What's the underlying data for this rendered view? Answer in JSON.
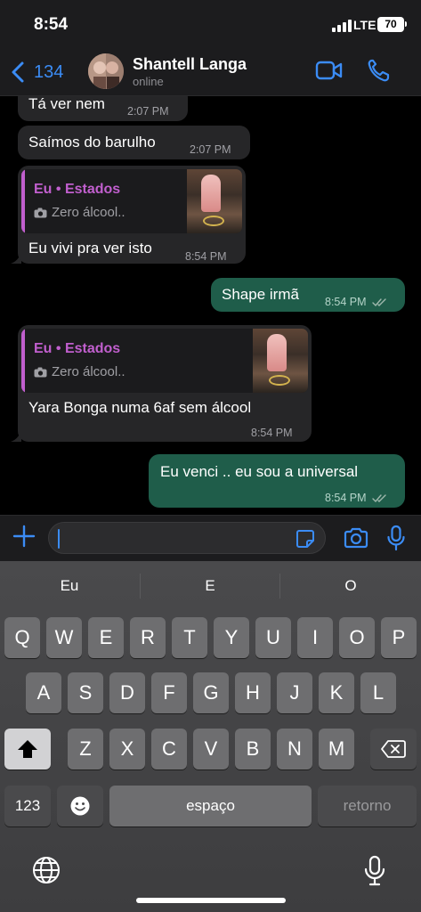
{
  "status_bar": {
    "time": "8:54",
    "network": "LTE",
    "battery": "70"
  },
  "header": {
    "back_count": "134",
    "contact_name": "Shantell Langa",
    "contact_status": "online",
    "icons": {
      "back": "chevron-left-icon",
      "video": "video-camera-icon",
      "call": "phone-icon"
    }
  },
  "messages": [
    {
      "direction": "in",
      "text": "Tá ver nem",
      "time": "2:07 PM"
    },
    {
      "direction": "in",
      "text": "Saímos do barulho",
      "time": "2:07 PM"
    },
    {
      "direction": "in",
      "quote_author": "Eu • Estados",
      "quote_text": "Zero álcool..",
      "text": "Eu vivi pra ver isto",
      "time": "8:54 PM"
    },
    {
      "direction": "out",
      "text": "Shape irmã",
      "time": "8:54 PM",
      "status": "read"
    },
    {
      "direction": "in",
      "quote_author": "Eu • Estados",
      "quote_text": "Zero álcool..",
      "text": "Yara Bonga numa 6af sem álcool",
      "time": "8:54 PM"
    },
    {
      "direction": "out",
      "text": "Eu venci .. eu sou a universal",
      "time": "8:54 PM",
      "status": "read"
    }
  ],
  "input_bar": {
    "value": "",
    "icons": [
      "plus-icon",
      "sticker-icon",
      "camera-icon",
      "microphone-icon"
    ]
  },
  "keyboard": {
    "suggestions": [
      "Eu",
      "E",
      "O"
    ],
    "rows": [
      [
        "Q",
        "W",
        "E",
        "R",
        "T",
        "Y",
        "U",
        "I",
        "O",
        "P"
      ],
      [
        "A",
        "S",
        "D",
        "F",
        "G",
        "H",
        "J",
        "K",
        "L"
      ],
      [
        "Z",
        "X",
        "C",
        "V",
        "B",
        "N",
        "M"
      ]
    ],
    "numbers_label": "123",
    "space_label": "espaço",
    "return_label": "retorno"
  },
  "colors": {
    "accent": "#3b8cf5",
    "outgoing_bubble": "#1f5d4a",
    "incoming_bubble": "#262628",
    "quote_author": "#c15fce"
  }
}
